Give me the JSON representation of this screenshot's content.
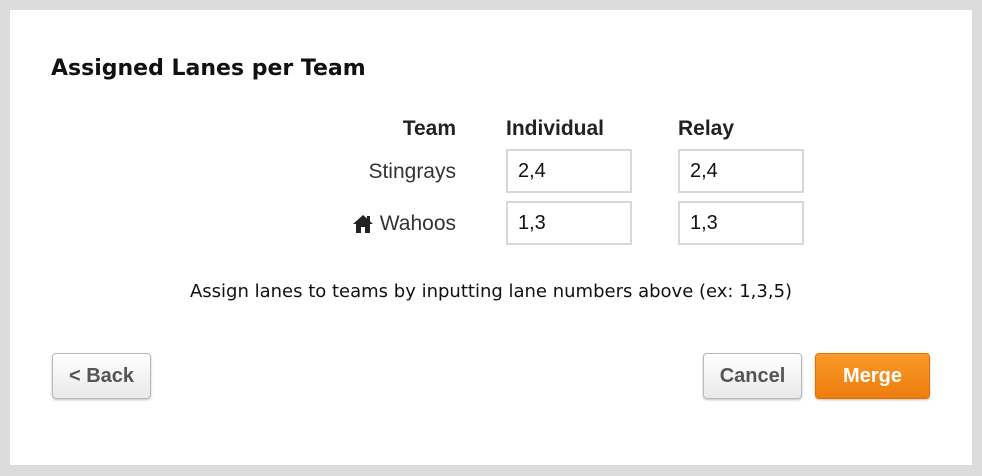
{
  "title": "Assigned Lanes per Team",
  "table": {
    "headers": {
      "team": "Team",
      "individual": "Individual",
      "relay": "Relay"
    },
    "rows": [
      {
        "team": "Stingrays",
        "home": false,
        "individual": "2,4",
        "relay": "2,4"
      },
      {
        "team": "Wahoos",
        "home": true,
        "home_icon": "house-icon",
        "individual": "1,3",
        "relay": "1,3"
      }
    ]
  },
  "hint": "Assign lanes to teams by inputting lane numbers above (ex: 1,3,5)",
  "buttons": {
    "back": "< Back",
    "cancel": "Cancel",
    "merge": "Merge"
  },
  "colors": {
    "accent": "#f38a1a",
    "background": "#dcdcdc"
  }
}
